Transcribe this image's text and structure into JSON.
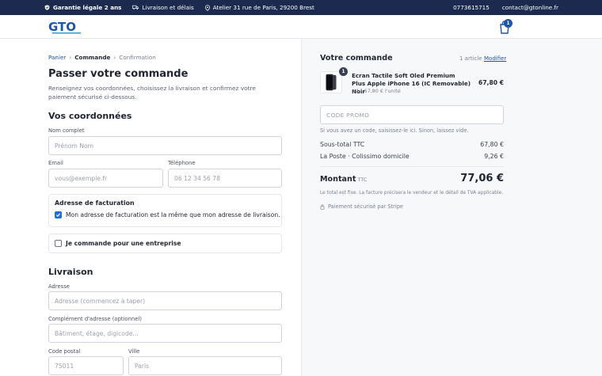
{
  "topbar": {
    "guarantee": "Garantie légale 2 ans",
    "delivery": "Livraison et délais",
    "address": "Atelier 31 rue de Paris, 29200 Brest",
    "phone": "0773615715",
    "email": "contact@gtonline.fr"
  },
  "header": {
    "logo_text": "GTO",
    "cart_count": "1"
  },
  "breadcrumb": {
    "items": [
      "Panier",
      "Commande",
      "Confirmation"
    ],
    "separator": "›"
  },
  "checkout": {
    "title": "Passer votre commande",
    "intro": "Renseignez vos coordonnées, choisissez la livraison et confirmez votre paiement sécurisé ci-dessous."
  },
  "contact": {
    "title": "Vos coordonnées",
    "fullname_label": "Nom complet",
    "fullname_placeholder": "Prénom Nom",
    "email_label": "Email",
    "email_placeholder": "vous@exemple.fr",
    "phone_label": "Téléphone",
    "phone_placeholder": "06 12 34 56 78"
  },
  "billing": {
    "title": "Adresse de facturation",
    "same_address_label": "Mon adresse de facturation est la même que mon adresse de livraison.",
    "same_address_checked": true
  },
  "company": {
    "label": "Je commande pour une entreprise",
    "checked": false
  },
  "shipping": {
    "title": "Livraison",
    "address_label": "Adresse",
    "address_placeholder": "Adresse (commencez à taper)",
    "complement_label": "Complément d'adresse (optionnel)",
    "complement_placeholder": "Bâtiment, étage, digicode...",
    "postal_label": "Code postal",
    "postal_placeholder": "75011",
    "city_label": "Ville",
    "city_placeholder": "Paris"
  },
  "order": {
    "title": "Votre commande",
    "count": "1 article",
    "modify": "Modifier",
    "product": {
      "name": "Ecran Tactile Soft Oled Premium Plus Apple iPhone 16 (IC Removable) Noir",
      "qty_badge": "1",
      "unit": "×1 · 67,80 € l'unité",
      "price": "67,80 €"
    },
    "promo_placeholder": "CODE PROMO",
    "promo_hint": "Si vous avez un code, saisissez-le ici. Sinon, laissez vide.",
    "subtotal_label": "Sous-total TTC",
    "subtotal_value": "67,80 €",
    "shipping_label": "La Poste · Colissimo domicile",
    "shipping_value": "9,26 €",
    "total_label": "Montant",
    "total_suffix": "TTC",
    "total_value": "77,06 €",
    "total_note": "Le total est fixe. La facture précisera le vendeur et le détail de TVA applicable.",
    "secure_label": "Paiement sécurisé par Stripe"
  },
  "colors": {
    "topbar": "#1b2a4e",
    "accent": "#1f55a6",
    "checkbox": "#1f6fd1"
  }
}
